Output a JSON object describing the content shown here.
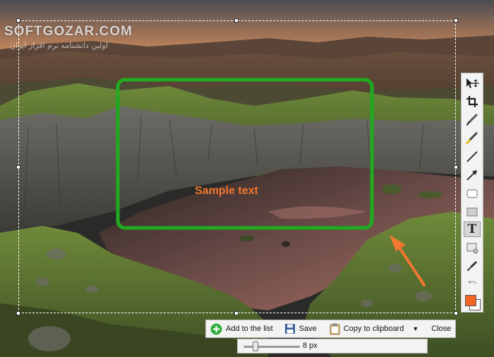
{
  "watermark": {
    "title": "SOFTGOZAR.COM",
    "subtitle": "اولین دانشنامه نرم افزار ایران"
  },
  "canvas": {
    "sample_text": "Sample text",
    "rectangle_color": "#1faa1f",
    "arrow_color": "#f07830"
  },
  "tools": {
    "items": [
      {
        "name": "select-move",
        "icon": "select-move-icon"
      },
      {
        "name": "crop",
        "icon": "crop-icon"
      },
      {
        "name": "pen",
        "icon": "pen-icon"
      },
      {
        "name": "highlighter",
        "icon": "highlighter-icon"
      },
      {
        "name": "line",
        "icon": "line-icon"
      },
      {
        "name": "arrow",
        "icon": "arrow-icon"
      },
      {
        "name": "rounded-rectangle",
        "icon": "rounded-rectangle-icon"
      },
      {
        "name": "filled-rectangle",
        "icon": "filled-rectangle-icon"
      },
      {
        "name": "text",
        "icon": "text-icon",
        "glyph": "T"
      },
      {
        "name": "eraser",
        "icon": "eraser-icon"
      },
      {
        "name": "color-picker",
        "icon": "eyedropper-icon"
      },
      {
        "name": "undo",
        "icon": "undo-icon"
      }
    ],
    "active": "text",
    "foreground_color": "#f26522",
    "background_color": "#ffffff"
  },
  "actions": {
    "add_to_list": "Add to the list",
    "save": "Save",
    "copy_to_clipboard": "Copy to clipboard",
    "close": "Close"
  },
  "brush": {
    "size_label": "8 px",
    "size_value": 8,
    "size_fraction": 0.18
  }
}
